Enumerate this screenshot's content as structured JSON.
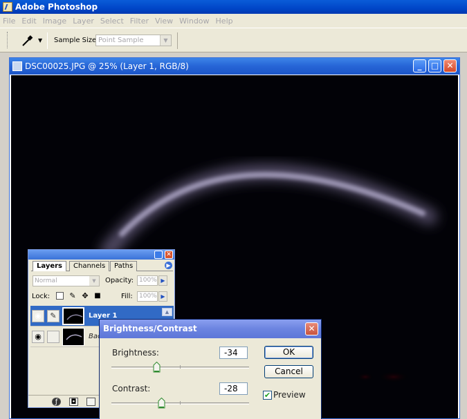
{
  "app": {
    "title": "Adobe Photoshop"
  },
  "menu": [
    "File",
    "Edit",
    "Image",
    "Layer",
    "Select",
    "Filter",
    "View",
    "Window",
    "Help"
  ],
  "options_bar": {
    "tool_icon": "eyedropper-icon",
    "sample_size_label": "Sample Size:",
    "sample_size_value": "Point Sample"
  },
  "document": {
    "title": "DSC00025.JPG @ 25% (Layer 1, RGB/8)"
  },
  "layers_panel": {
    "tabs": [
      "Layers",
      "Channels",
      "Paths"
    ],
    "blend_mode": "Normal",
    "opacity_label": "Opacity:",
    "opacity_value": "100%",
    "lock_label": "Lock:",
    "fill_label": "Fill:",
    "fill_value": "100%",
    "layers": [
      {
        "name": "Layer 1",
        "selected": true
      },
      {
        "name": "Bac",
        "selected": false
      }
    ]
  },
  "brightness_contrast": {
    "title": "Brightness/Contrast",
    "brightness_label": "Brightness:",
    "brightness_value": "-34",
    "contrast_label": "Contrast:",
    "contrast_value": "-28",
    "ok_label": "OK",
    "cancel_label": "Cancel",
    "preview_label": "Preview",
    "preview_checked": true
  },
  "colors": {
    "title_bar": "#0046c8",
    "canvas_bg": "#020207",
    "moon_glow": "#9e97b5",
    "selection": "#316ac5"
  }
}
